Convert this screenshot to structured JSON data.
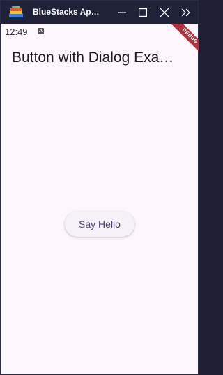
{
  "window": {
    "title": "BlueStacks Ap…"
  },
  "status_bar": {
    "time": "12:49",
    "notification_glyph": "A"
  },
  "debug_banner": {
    "label": "DEBUG"
  },
  "app_bar": {
    "title": "Button with Dialog Exa…"
  },
  "main": {
    "button_label": "Say Hello"
  },
  "colors": {
    "titlebar_bg": "#20223a",
    "page_bg": "#fdf7fd",
    "debug_ribbon": "#a8353f",
    "button_text": "#4a4470"
  }
}
